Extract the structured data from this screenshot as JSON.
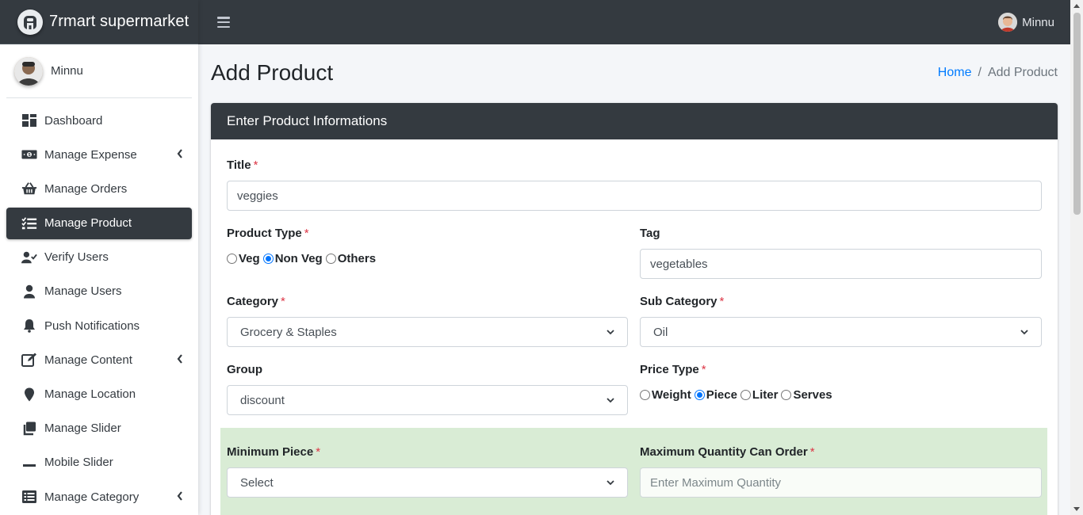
{
  "brand": {
    "name": "7rmart supermarket"
  },
  "user": {
    "name": "Minnu"
  },
  "sidebar": {
    "items": [
      {
        "label": "Dashboard",
        "icon": "dashboard-icon"
      },
      {
        "label": "Manage Expense",
        "icon": "money-icon",
        "has_submenu": true
      },
      {
        "label": "Manage Orders",
        "icon": "basket-icon"
      },
      {
        "label": "Manage Product",
        "icon": "list-check-icon",
        "active": true
      },
      {
        "label": "Verify Users",
        "icon": "user-check-icon"
      },
      {
        "label": "Manage Users",
        "icon": "user-icon"
      },
      {
        "label": "Push Notifications",
        "icon": "bell-icon"
      },
      {
        "label": "Manage Content",
        "icon": "edit-icon",
        "has_submenu": true
      },
      {
        "label": "Manage Location",
        "icon": "map-marker-icon"
      },
      {
        "label": "Manage Slider",
        "icon": "clone-icon"
      },
      {
        "label": "Mobile Slider",
        "icon": "minus-icon"
      },
      {
        "label": "Manage Category",
        "icon": "list-alt-icon",
        "has_submenu": true
      }
    ]
  },
  "header": {
    "title": "Add Product",
    "breadcrumb": {
      "home": "Home",
      "separator": "/",
      "current": "Add Product"
    }
  },
  "form": {
    "card_title": "Enter Product Informations",
    "required_mark": "*",
    "title": {
      "label": "Title",
      "value": "veggies"
    },
    "product_type": {
      "label": "Product Type",
      "options": [
        "Veg",
        "Non Veg",
        "Others"
      ],
      "selected": "Non Veg"
    },
    "tag": {
      "label": "Tag",
      "value": "vegetables"
    },
    "category": {
      "label": "Category",
      "value": "Grocery & Staples"
    },
    "sub_category": {
      "label": "Sub Category",
      "value": "Oil"
    },
    "group": {
      "label": "Group",
      "value": "discount"
    },
    "price_type": {
      "label": "Price Type",
      "options": [
        "Weight",
        "Piece",
        "Liter",
        "Serves"
      ],
      "selected": "Piece"
    },
    "minimum_piece": {
      "label": "Minimum Piece",
      "value": "Select"
    },
    "max_quantity": {
      "label": "Maximum Quantity Can Order",
      "placeholder": "Enter Maximum Quantity"
    }
  },
  "colors": {
    "navbar": "#343a40",
    "active_nav": "#343a40",
    "link": "#007bff",
    "required": "#dc3545",
    "highlight_band": "#d9ecd5"
  }
}
